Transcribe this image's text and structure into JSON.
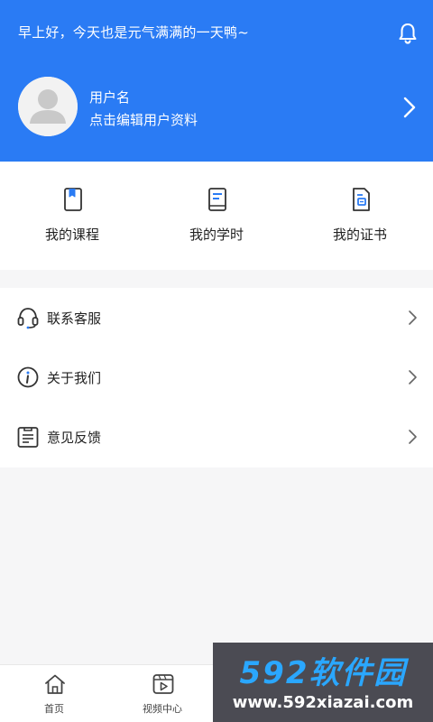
{
  "header": {
    "greeting": "早上好，今天也是元气满满的一天鸭~",
    "username": "用户名",
    "edit_hint": "点击编辑用户资料",
    "bg_color": "#2a7bf4"
  },
  "quick_actions": [
    {
      "label": "我的课程",
      "icon": "course-book-icon"
    },
    {
      "label": "我的学时",
      "icon": "study-hours-book-icon"
    },
    {
      "label": "我的证书",
      "icon": "certificate-doc-icon"
    }
  ],
  "menu": [
    {
      "label": "联系客服",
      "icon": "headset-icon"
    },
    {
      "label": "关于我们",
      "icon": "info-icon"
    },
    {
      "label": "意见反馈",
      "icon": "feedback-clipboard-icon"
    }
  ],
  "tabbar": [
    {
      "label": "首页",
      "icon": "home-icon"
    },
    {
      "label": "视频中心",
      "icon": "video-icon"
    },
    {
      "label": "",
      "icon": "tab-icon"
    },
    {
      "label": "",
      "icon": "user-icon"
    }
  ],
  "watermark": {
    "title": "592软件园",
    "url": "www.592xiazai.com"
  }
}
